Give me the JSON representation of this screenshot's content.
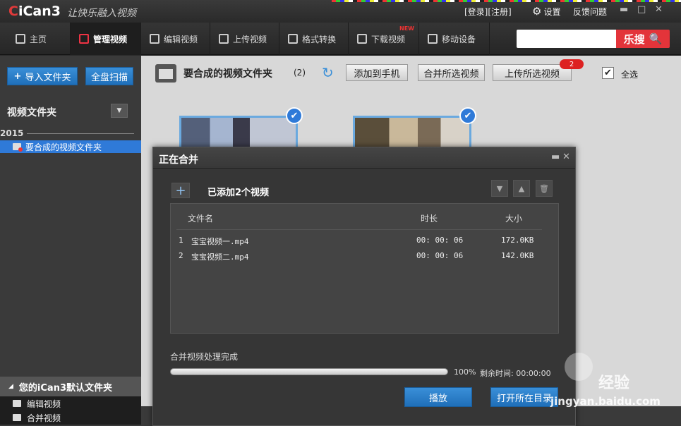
{
  "app": {
    "logo": "iCan3",
    "logo_prefix": "C",
    "slogan": "让快乐融入视频"
  },
  "topbar": {
    "login_register": "[登录][注册]",
    "settings": "设置",
    "feedback": "反馈问题"
  },
  "nav": {
    "items": [
      "主页",
      "管理视频",
      "编辑视频",
      "上传视频",
      "格式转换",
      "下载视频",
      "移动设备"
    ],
    "new_badge": "NEW",
    "search_btn": "乐搜"
  },
  "sidebar": {
    "import_btn": "导入文件夹",
    "scan_btn": "全盘扫描",
    "title": "视频文件夹",
    "year": "2015",
    "selected_folder": "要合成的视频文件夹",
    "default_header": "您的iCan3默认文件夹",
    "default_items": [
      "编辑视频",
      "合并视频"
    ]
  },
  "main": {
    "title": "要合成的视频文件夹",
    "count": "(2)",
    "btn_add_phone": "添加到手机",
    "btn_merge": "合并所选视频",
    "btn_upload": "上传所选视频",
    "upload_badge": "2",
    "select_all": "全选"
  },
  "dialog": {
    "title": "正在合并",
    "added_label": "已添加2个视频",
    "columns": [
      "文件名",
      "时长",
      "大小"
    ],
    "rows": [
      {
        "index": "1",
        "name": "宝宝视频一.mp4",
        "duration": "00: 00: 06",
        "size": "172.0KB"
      },
      {
        "index": "2",
        "name": "宝宝视频二.mp4",
        "duration": "00: 00: 06",
        "size": "142.0KB"
      }
    ],
    "status": "合并视频处理完成",
    "progress_pct": "100%",
    "progress_value": 1.0,
    "remaining": "剩余时间: 00:00:00",
    "play_btn": "播放",
    "open_dir_btn": "打开所在目录"
  },
  "watermark": {
    "text1": "经验",
    "text2": "jingyan.baidu.com"
  },
  "colors": {
    "accent_blue": "#2f7ad8",
    "brand_red": "#e3343a"
  }
}
